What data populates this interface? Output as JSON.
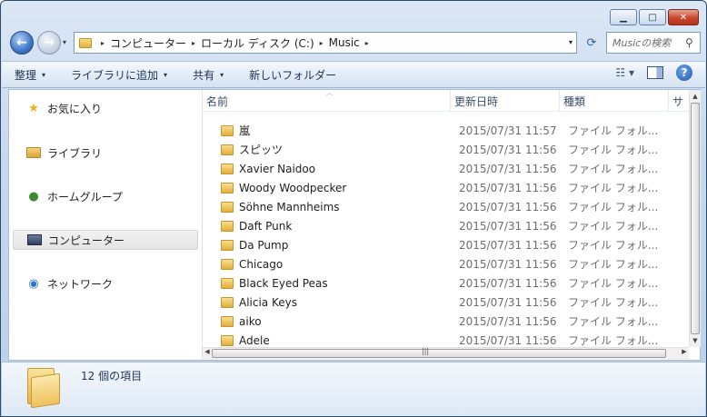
{
  "window": {
    "controls": {
      "minimize": "▁",
      "maximize": "□",
      "close": "✕"
    }
  },
  "nav": {
    "back_icon": "arrow-left-icon",
    "forward_icon": "arrow-right-icon",
    "dropdown": "▾"
  },
  "address": {
    "crumbs": [
      "コンピューター",
      "ローカル ディスク (C:)",
      "Music"
    ],
    "separator": "▸",
    "dropdown": "▾"
  },
  "search": {
    "placeholder": "Musicの検索"
  },
  "toolbar": {
    "items": [
      {
        "label": "整理",
        "has_dropdown": true
      },
      {
        "label": "ライブラリに追加",
        "has_dropdown": true
      },
      {
        "label": "共有",
        "has_dropdown": true
      },
      {
        "label": "新しいフォルダー",
        "has_dropdown": false
      }
    ],
    "dropdown_arrow": "▾"
  },
  "sidebar": {
    "items": [
      {
        "label": "お気に入り",
        "icon": "star-icon"
      },
      {
        "label": "ライブラリ",
        "icon": "library-icon"
      },
      {
        "label": "ホームグループ",
        "icon": "homegroup-icon"
      },
      {
        "label": "コンピューター",
        "icon": "computer-icon",
        "selected": true
      },
      {
        "label": "ネットワーク",
        "icon": "network-icon"
      }
    ]
  },
  "columns": {
    "name": "名前",
    "date": "更新日時",
    "type": "種類",
    "size": "サ"
  },
  "files": [
    {
      "name": "嵐",
      "date": "2015/07/31 11:57",
      "type": "ファイル フォル..."
    },
    {
      "name": "スピッツ",
      "date": "2015/07/31 11:56",
      "type": "ファイル フォル..."
    },
    {
      "name": "Xavier Naidoo",
      "date": "2015/07/31 11:56",
      "type": "ファイル フォル..."
    },
    {
      "name": "Woody Woodpecker",
      "date": "2015/07/31 11:56",
      "type": "ファイル フォル..."
    },
    {
      "name": "Söhne Mannheims",
      "date": "2015/07/31 11:56",
      "type": "ファイル フォル..."
    },
    {
      "name": "Daft Punk",
      "date": "2015/07/31 11:56",
      "type": "ファイル フォル..."
    },
    {
      "name": "Da Pump",
      "date": "2015/07/31 11:56",
      "type": "ファイル フォル..."
    },
    {
      "name": "Chicago",
      "date": "2015/07/31 11:56",
      "type": "ファイル フォル..."
    },
    {
      "name": "Black Eyed Peas",
      "date": "2015/07/31 11:56",
      "type": "ファイル フォル..."
    },
    {
      "name": "Alicia Keys",
      "date": "2015/07/31 11:56",
      "type": "ファイル フォル..."
    },
    {
      "name": "aiko",
      "date": "2015/07/31 11:56",
      "type": "ファイル フォル..."
    },
    {
      "name": "Adele",
      "date": "2015/07/31 11:56",
      "type": "ファイル フォル..."
    }
  ],
  "details": {
    "item_count": "12 個の項目"
  },
  "colors": {
    "accent": "#1e3355",
    "selection": "#e4e4e4",
    "folder": "#e4b13e"
  }
}
